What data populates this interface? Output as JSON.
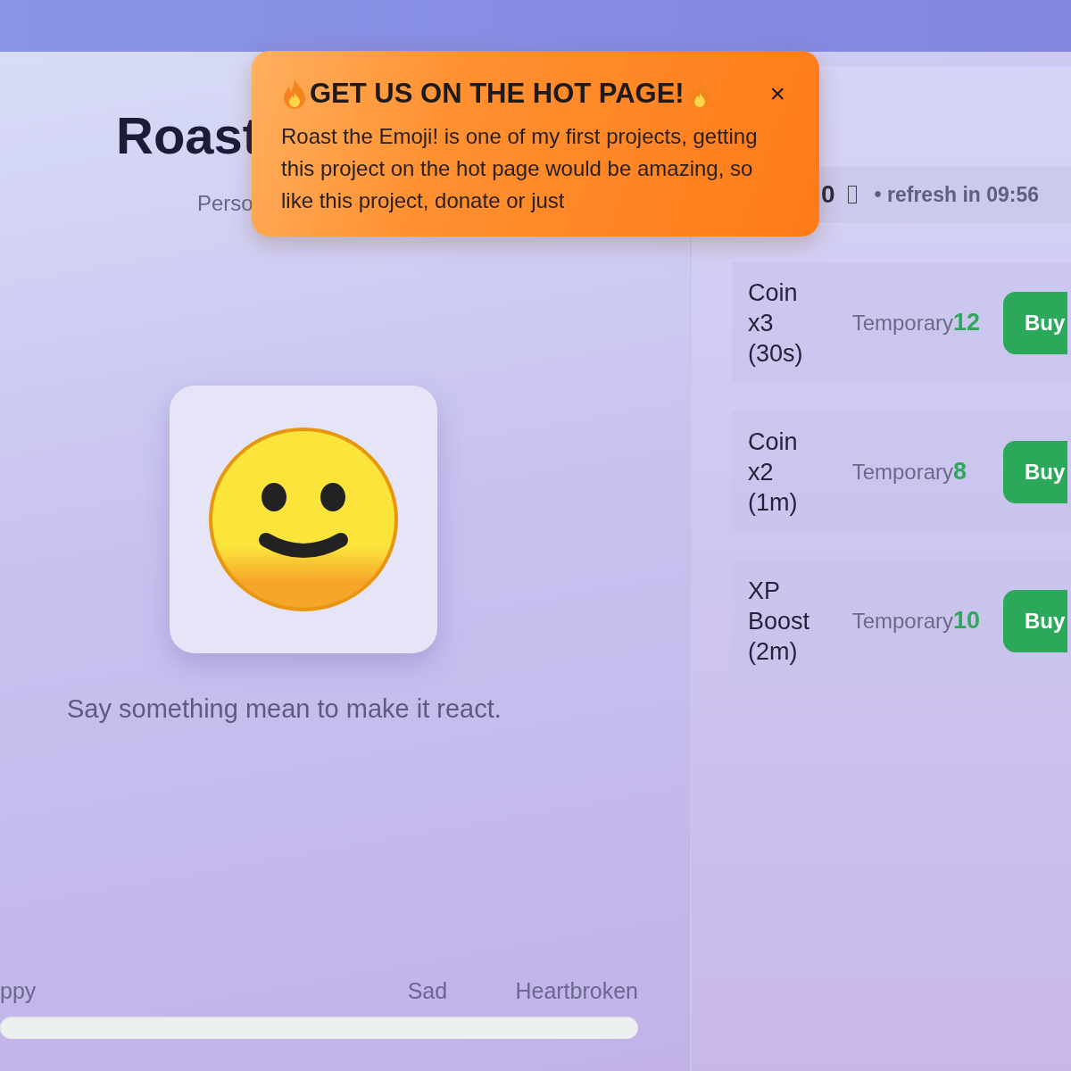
{
  "header": {
    "title": "Roast",
    "subtitle": "Perso"
  },
  "emoji_caption": "Say something mean to make it react.",
  "mood_scale": {
    "labels": [
      "ppy",
      "Sad",
      "Heartbroken"
    ],
    "level": 0
  },
  "stats": {
    "coins": "0",
    "refresh": "• refresh in 09:56"
  },
  "shop": [
    {
      "name": "Coin x3 (30s)",
      "type": "Temporary",
      "price": "12",
      "button": "Buy"
    },
    {
      "name": "Coin x2 (1m)",
      "type": "Temporary",
      "price": "8",
      "button": "Buy"
    },
    {
      "name": "XP Boost (2m)",
      "type": "Temporary",
      "price": "10",
      "button": "Buy"
    }
  ],
  "toast": {
    "title": "GET US ON THE HOT PAGE!",
    "body": "Roast the Emoji! is one of my first projects, getting this project on the hot page would be amazing, so like this project, donate or just",
    "close": "×"
  }
}
